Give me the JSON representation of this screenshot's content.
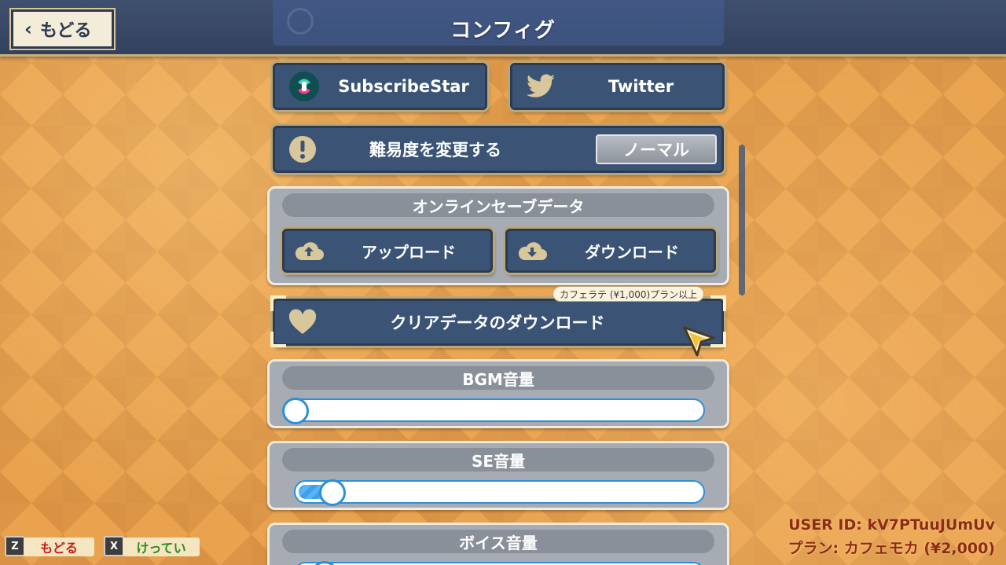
{
  "header": {
    "title": "コンフィグ",
    "back_label": "もどる"
  },
  "links": {
    "subscribestar_label": "SubscribeStar",
    "twitter_label": "Twitter"
  },
  "difficulty": {
    "label": "難易度を変更する",
    "value": "ノーマル"
  },
  "online_save": {
    "header": "オンラインセーブデータ",
    "upload_label": "アップロード",
    "download_label": "ダウンロード"
  },
  "clear_data": {
    "label": "クリアデータのダウンロード",
    "plan_tag": "カフェラテ (¥1,000)プラン以上"
  },
  "sliders": {
    "bgm": {
      "label": "BGM音量",
      "value": 0.0
    },
    "se": {
      "label": "SE音量",
      "value": 0.07
    },
    "voice": {
      "label": "ボイス音量",
      "value": 0.05
    }
  },
  "footer": {
    "key_back": "Z",
    "back_label": "もどる",
    "key_confirm": "X",
    "confirm_label": "けってい",
    "user_id": "USER ID: kV7PTuuJUmUv",
    "plan": "プラン: カフェモカ (¥2,000)"
  },
  "colors": {
    "panel_navy": "#3b5476",
    "slider_blue": "#2d8fd8",
    "footer_back": "#c0201a",
    "footer_confirm": "#2f8a1e",
    "user_info": "#8f2b12"
  }
}
